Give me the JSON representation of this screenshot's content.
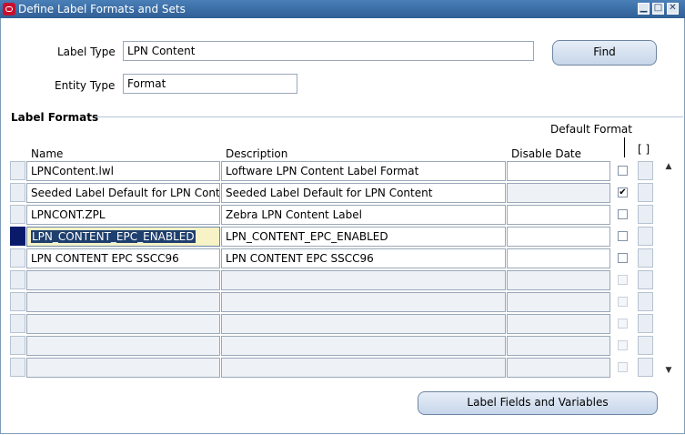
{
  "window": {
    "title": "Define Label Formats and Sets"
  },
  "form": {
    "label_type_label": "Label Type",
    "label_type_value": "LPN Content",
    "entity_type_label": "Entity Type",
    "entity_type_value": "Format",
    "find_button": "Find"
  },
  "section": {
    "title": "Label Formats",
    "default_format_header": "Default Format",
    "bracket_header": "[ ]"
  },
  "table": {
    "columns": {
      "name": "Name",
      "description": "Description",
      "disable_date": "Disable Date"
    },
    "rows": [
      {
        "name": "LPNContent.lwl",
        "description": "Loftware LPN Content Label Format",
        "disable_date": "",
        "default": false
      },
      {
        "name": "Seeded Label Default for LPN Conte",
        "description": "Seeded Label Default for LPN Content",
        "disable_date": "",
        "default": true
      },
      {
        "name": "LPNCONT.ZPL",
        "description": "Zebra LPN Content Label",
        "disable_date": "",
        "default": false
      },
      {
        "name": "LPN_CONTENT_EPC_ENABLED",
        "description": "LPN_CONTENT_EPC_ENABLED",
        "disable_date": "",
        "default": false
      },
      {
        "name": "LPN CONTENT EPC SSCC96",
        "description": "LPN CONTENT EPC SSCC96",
        "disable_date": "",
        "default": false
      },
      {
        "name": "",
        "description": "",
        "disable_date": "",
        "default": false
      },
      {
        "name": "",
        "description": "",
        "disable_date": "",
        "default": false
      },
      {
        "name": "",
        "description": "",
        "disable_date": "",
        "default": false
      },
      {
        "name": "",
        "description": "",
        "disable_date": "",
        "default": false
      },
      {
        "name": "",
        "description": "",
        "disable_date": "",
        "default": false
      }
    ],
    "check_mark": "✔"
  },
  "footer": {
    "label_fields_button": "Label Fields and Variables"
  },
  "icons": {
    "window_minimize": "▁",
    "window_maximize": "□",
    "window_close": "✕",
    "scroll_up": "▲",
    "scroll_down": "▼"
  }
}
